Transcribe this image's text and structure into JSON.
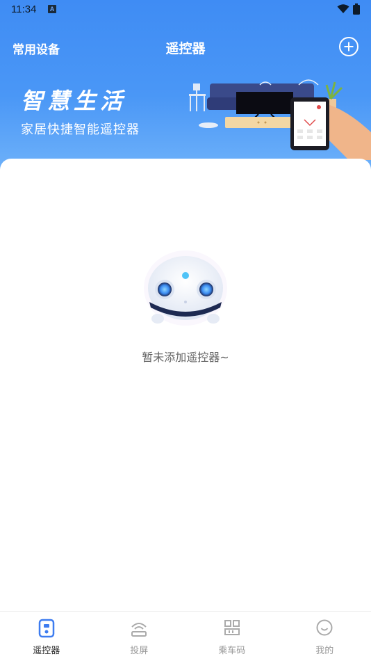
{
  "status_bar": {
    "time": "11:34",
    "notification_icon": "a-icon",
    "wifi_icon": "wifi-icon",
    "battery_icon": "battery-icon"
  },
  "header": {
    "left_label": "常用设备",
    "title": "遥控器",
    "add_icon": "plus-circle-icon"
  },
  "banner": {
    "title": "智慧生活",
    "subtitle": "家居快捷智能遥控器"
  },
  "empty_state": {
    "message": "暂未添加遥控器~",
    "image": "robot-mascot"
  },
  "bottom_nav": {
    "items": [
      {
        "label": "遥控器",
        "icon": "remote-icon",
        "active": true
      },
      {
        "label": "投屏",
        "icon": "cast-icon",
        "active": false
      },
      {
        "label": "乘车码",
        "icon": "qr-code-icon",
        "active": false
      },
      {
        "label": "我的",
        "icon": "smile-icon",
        "active": false
      }
    ]
  },
  "colors": {
    "header_gradient_top": "#3f8cf4",
    "header_gradient_bottom": "#6fb2fa",
    "active_nav": "#3d7cf0",
    "inactive_nav": "#999999"
  }
}
